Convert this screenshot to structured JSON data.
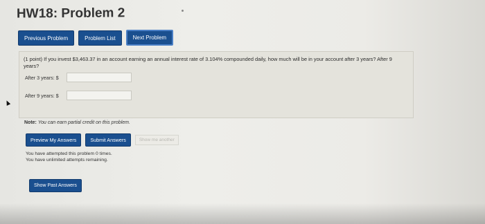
{
  "page": {
    "title": "HW18: Problem 2"
  },
  "nav": {
    "previous": "Previous Problem",
    "list": "Problem List",
    "next": "Next Problem"
  },
  "problem": {
    "text": "(1 point) If you invest $3,463.37 in an account earning an annual interest rate of 3.104% compounded daily, how much will be in your account after 3 years? After 9 years?",
    "answer1_label": "After 3 years: $",
    "answer1_value": "",
    "answer2_label": "After 9 years: $",
    "answer2_value": ""
  },
  "note": {
    "label": "Note:",
    "text": "You can earn partial credit on this problem."
  },
  "actions": {
    "preview": "Preview My Answers",
    "submit": "Submit Answers",
    "show_another": "Show me another"
  },
  "attempts": {
    "line1": "You have attempted this problem 0 times.",
    "line2": "You have unlimited attempts remaining."
  },
  "past": {
    "label": "Show Past Answers"
  },
  "colors": {
    "button_blue": "#1a4f8f",
    "problem_bg": "#e4e3dc"
  }
}
